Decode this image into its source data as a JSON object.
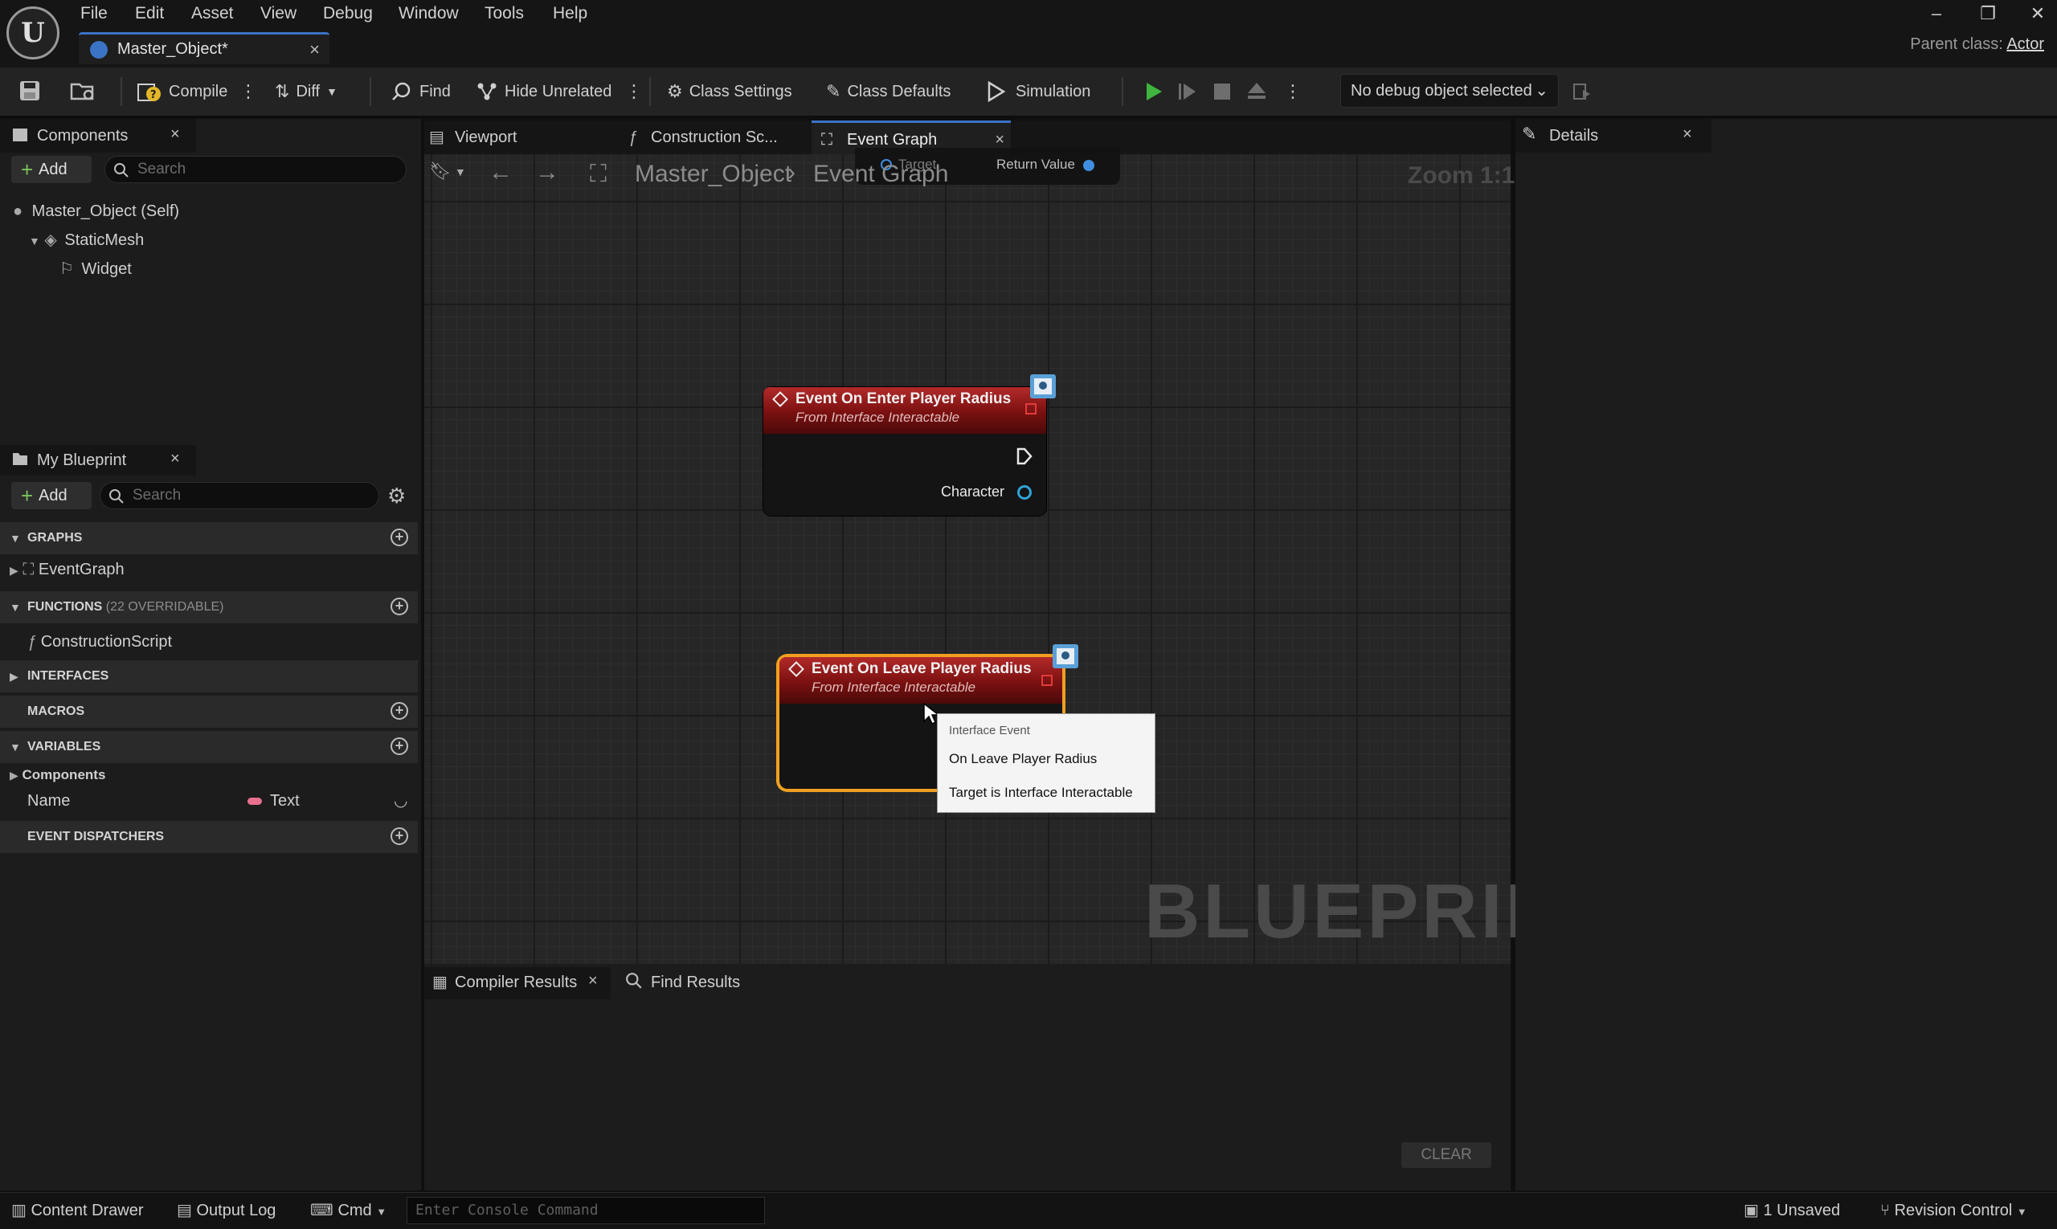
{
  "app": {
    "menu": [
      "File",
      "Edit",
      "Asset",
      "View",
      "Debug",
      "Window",
      "Tools",
      "Help"
    ],
    "document_tab": "Master_Object*",
    "parent_class_label": "Parent class:",
    "parent_class_value": "Actor"
  },
  "toolbar": {
    "compile": "Compile",
    "diff": "Diff",
    "find": "Find",
    "hide_unrelated": "Hide Unrelated",
    "class_settings": "Class Settings",
    "class_defaults": "Class Defaults",
    "simulation": "Simulation",
    "debug_object": "No debug object selected"
  },
  "components_panel": {
    "title": "Components",
    "add": "Add",
    "search_placeholder": "Search",
    "tree": [
      {
        "label": "Master_Object (Self)"
      },
      {
        "label": "StaticMesh"
      },
      {
        "label": "Widget"
      }
    ]
  },
  "my_blueprint": {
    "title": "My Blueprint",
    "add": "Add",
    "search_placeholder": "Search",
    "graphs_header": "GRAPHS",
    "graph_item": "EventGraph",
    "functions_header": "FUNCTIONS",
    "functions_sub": "(22 OVERRIDABLE)",
    "function_item": "ConstructionScript",
    "interfaces_header": "INTERFACES",
    "macros_header": "MACROS",
    "variables_header": "VARIABLES",
    "var_category": "Components",
    "var_name": "Name",
    "var_type": "Text",
    "dispatchers_header": "EVENT DISPATCHERS"
  },
  "editor_tabs": {
    "viewport": "Viewport",
    "construction": "Construction Sc...",
    "event_graph": "Event Graph"
  },
  "graph": {
    "breadcrumb_root": "Master_Object",
    "breadcrumb_current": "Event Graph",
    "zoom": "Zoom 1:1",
    "partial_node_target": "Target",
    "partial_node_return": "Return Value",
    "watermark": "BLUEPRINT",
    "nodes": [
      {
        "title": "Event On Enter Player Radius",
        "subtitle": "From Interface Interactable",
        "pin": "Character"
      },
      {
        "title": "Event On Leave Player Radius",
        "subtitle": "From Interface Interactable"
      }
    ],
    "tooltip": {
      "line1": "Interface Event",
      "line2": "On Leave Player Radius",
      "line3": "Target is Interface Interactable"
    }
  },
  "details_panel": {
    "title": "Details"
  },
  "bottom_panel": {
    "compiler_results": "Compiler Results",
    "find_results": "Find Results",
    "clear": "CLEAR"
  },
  "statusbar": {
    "content_drawer": "Content Drawer",
    "output_log": "Output Log",
    "cmd": "Cmd",
    "console_placeholder": "Enter Console Command",
    "unsaved": "1 Unsaved",
    "revision_control": "Revision Control"
  },
  "colors": {
    "accent": "#3b73c6",
    "event_node_header": "#b32a2a",
    "selected_outline": "#f0a020",
    "play_green": "#3fb53f"
  }
}
